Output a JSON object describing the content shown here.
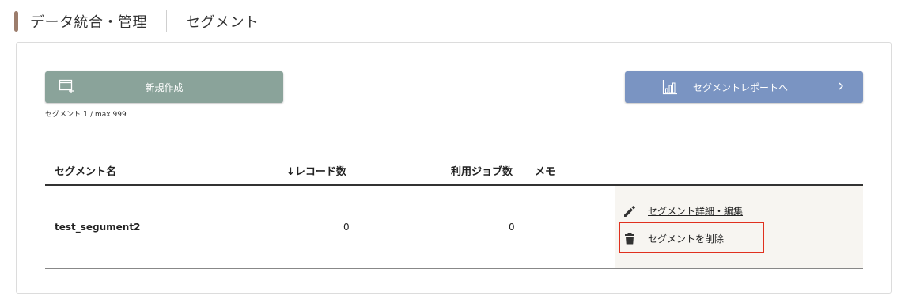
{
  "header": {
    "title": "データ統合・管理",
    "subtitle": "セグメント"
  },
  "toolbar": {
    "new_label": "新規作成",
    "count_prefix": "セグメント",
    "count_value": "1",
    "count_suffix": " / max 999",
    "report_label": "セグメントレポートへ"
  },
  "table": {
    "columns": {
      "name": "セグメント名",
      "records": "↓レコード数",
      "jobs": "利用ジョブ数",
      "memo": "メモ"
    },
    "rows": [
      {
        "name": "test_segument2",
        "records": "0",
        "jobs": "0",
        "memo": "",
        "edit_label": "セグメント詳細・編集",
        "delete_label": "セグメントを削除"
      }
    ]
  },
  "colors": {
    "accent": "#9c7d6c",
    "new_button": "#8aa39a",
    "report_button": "#7a94c2",
    "highlight": "#e0301e"
  },
  "icons": {
    "new": "add-window-icon",
    "report": "bar-chart-icon",
    "chevron": "chevron-right-icon",
    "edit": "pencil-icon",
    "delete": "trash-icon"
  }
}
